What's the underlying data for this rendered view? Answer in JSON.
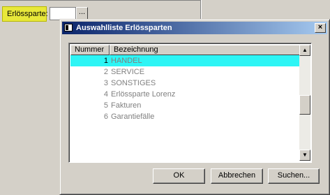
{
  "form": {
    "field_label": "Erlössparte:",
    "field_value": "",
    "browse_label": "..."
  },
  "dialog": {
    "title": "Auswahlliste Erlössparten",
    "close_label": "×"
  },
  "list": {
    "columns": [
      "Nummer",
      "Bezeichnung"
    ],
    "rows": [
      {
        "nummer": "1",
        "bezeichnung": "HANDEL"
      },
      {
        "nummer": "2",
        "bezeichnung": "SERVICE"
      },
      {
        "nummer": "3",
        "bezeichnung": "SONSTIGES"
      },
      {
        "nummer": "4",
        "bezeichnung": "Erlössparte Lorenz"
      },
      {
        "nummer": "5",
        "bezeichnung": "Fakturen"
      },
      {
        "nummer": "6",
        "bezeichnung": "Garantiefälle"
      }
    ],
    "selected_index": 0,
    "scroll_up": "▲",
    "scroll_down": "▼"
  },
  "buttons": {
    "ok": "OK",
    "cancel": "Abbrechen",
    "search": "Suchen..."
  },
  "colors": {
    "selection": "#2df5f5",
    "highlight_label": "#e8e83a",
    "title_start": "#0a246a",
    "title_end": "#a6caf0"
  }
}
